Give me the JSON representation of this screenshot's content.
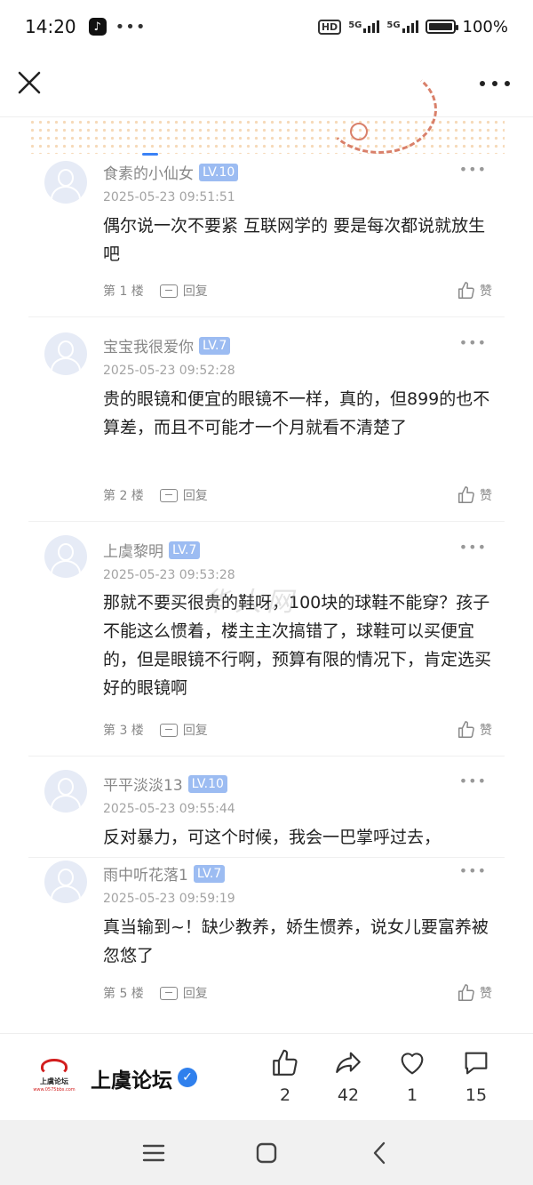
{
  "status_bar": {
    "time": "14:20",
    "dots": "•••",
    "hd": "HD",
    "net1": "5G",
    "net2": "5G",
    "battery": "100%"
  },
  "colors": {
    "lv_badge": "#9cbcf2",
    "verified": "#2f80ed",
    "text_meta": "#888888"
  },
  "watermark": "华人网",
  "comments": [
    {
      "name": "食素的小仙女",
      "level": "LV.10",
      "time": "2025-05-23 09:51:51",
      "text": "偶尔说一次不要紧   互联网学的  要是每次都说就放生吧",
      "floor": "第 1 楼",
      "reply": "回复",
      "like": "赞"
    },
    {
      "name": "宝宝我很爱你",
      "level": "LV.7",
      "time": "2025-05-23 09:52:28",
      "text": "贵的眼镜和便宜的眼镜不一样，真的，但899的也不算差，而且不可能才一个月就看不清楚了",
      "floor": "第 2 楼",
      "reply": "回复",
      "like": "赞"
    },
    {
      "name": "上虞黎明",
      "level": "LV.7",
      "time": "2025-05-23 09:53:28",
      "text": "那就不要买很贵的鞋呀，100块的球鞋不能穿？孩子不能这么惯着，楼主主次搞错了，球鞋可以买便宜的，但是眼镜不行啊，预算有限的情况下，肯定选买好的眼镜啊",
      "floor": "第 3 楼",
      "reply": "回复",
      "like": "赞"
    },
    {
      "name": "平平淡淡13",
      "level": "LV.10",
      "time": "2025-05-23 09:55:44",
      "text": "反对暴力，可这个时候，我会一巴掌呼过去，",
      "floor": "",
      "reply": "",
      "like": ""
    },
    {
      "name": "雨中听花落1",
      "level": "LV.7",
      "time": "2025-05-23 09:59:19",
      "text": "真当输到~！缺少教养，娇生惯养，说女儿要富养被忽悠了",
      "floor": "第 5 楼",
      "reply": "回复",
      "like": "赞"
    }
  ],
  "bottom": {
    "forum_name": "上虞论坛",
    "logo_text": "上虞论坛",
    "logo_url": "www.0575bbs.com",
    "likes": "2",
    "shares": "42",
    "favorites": "1",
    "comments": "15"
  },
  "icons": [
    "close-icon",
    "more-icon",
    "reply-icon",
    "thumbs-up-icon",
    "share-icon",
    "heart-icon",
    "comment-icon",
    "verified-icon",
    "menu-icon",
    "home-icon",
    "back-icon"
  ]
}
